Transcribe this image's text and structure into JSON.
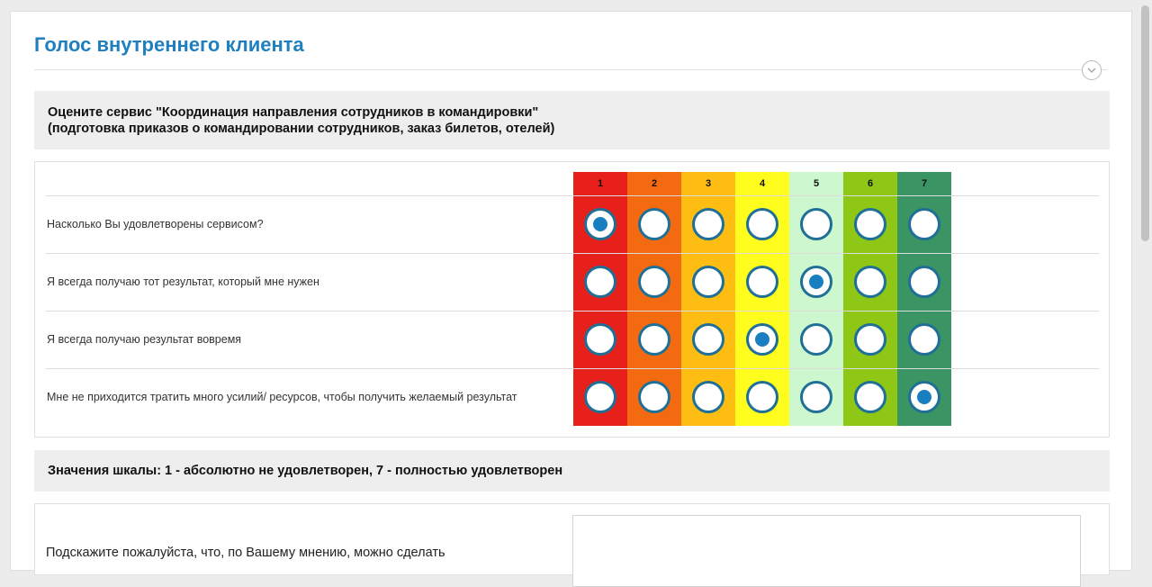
{
  "survey": {
    "title": "Голос внутреннего клиента",
    "question_header": {
      "line1": "Оцените сервис \"Координация направления сотрудников в командировки\"",
      "line2": "(подготовка приказов о командировании сотрудников, заказ билетов, отелей)"
    },
    "scale": {
      "columns": [
        {
          "label": "1",
          "color": "#e8201b"
        },
        {
          "label": "2",
          "color": "#f36a10"
        },
        {
          "label": "3",
          "color": "#fdbd12"
        },
        {
          "label": "4",
          "color": "#fefd1e"
        },
        {
          "label": "5",
          "color": "#ccf7cf"
        },
        {
          "label": "6",
          "color": "#8ec716"
        },
        {
          "label": "7",
          "color": "#3a9463"
        }
      ]
    },
    "rows": [
      {
        "label": "Насколько Вы удовлетворены сервисом?",
        "selected": 1
      },
      {
        "label": "Я всегда получаю тот результат, который мне нужен",
        "selected": 5
      },
      {
        "label": "Я всегда получаю результат вовремя",
        "selected": 4
      },
      {
        "label": "Мне не приходится тратить много усилий/ ресурсов, чтобы получить желаемый результат",
        "selected": 7
      }
    ],
    "scale_note": "Значения шкалы: 1 - абсолютно не удовлетворен, 7 - полностью удовлетворен",
    "comment_label": "Подскажите пожалуйста, что, по Вашему мнению, можно сделать"
  },
  "icons": {
    "collapse": "chevron-down-icon"
  }
}
